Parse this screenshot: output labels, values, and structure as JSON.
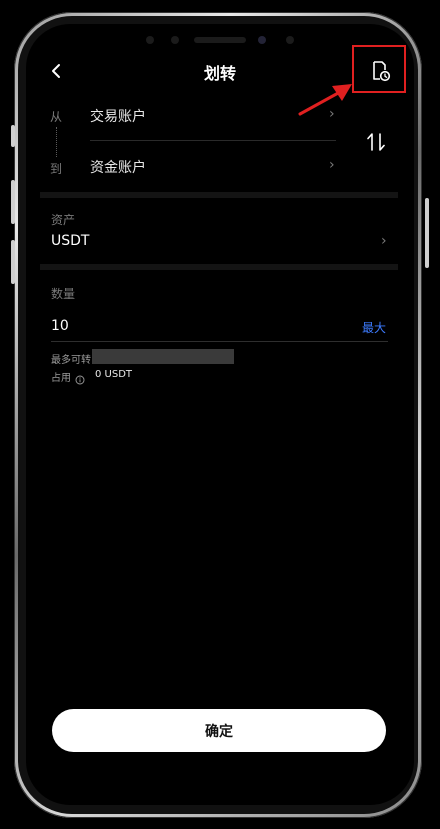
{
  "header": {
    "title": "划转"
  },
  "transfer": {
    "from_label": "从",
    "to_label": "到",
    "from_account": "交易账户",
    "to_account": "资金账户"
  },
  "asset": {
    "label": "资产",
    "value": "USDT"
  },
  "quantity": {
    "label": "数量",
    "value": "10",
    "max_label": "最大",
    "available_label": "最多可转",
    "occupied_label": "占用",
    "occupied_value": "0 USDT"
  },
  "confirm_label": "确定",
  "icons": {
    "back": "chevron-left-icon",
    "record": "transfer-history-icon",
    "swap": "swap-vertical-icon",
    "info": "info-icon"
  },
  "colors": {
    "accent": "#3d7bff",
    "annotation": "#e02020",
    "background": "#000000"
  }
}
